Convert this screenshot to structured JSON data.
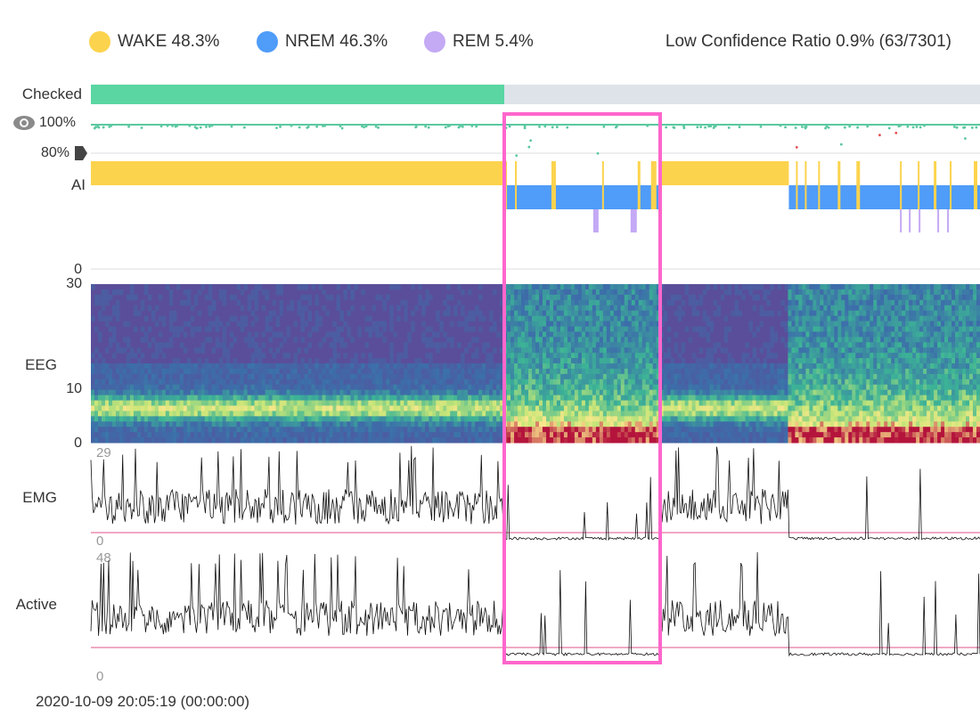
{
  "legend": {
    "items": [
      {
        "label": "WAKE 48.3%",
        "color": "#fcd34d"
      },
      {
        "label": "NREM 46.3%",
        "color": "#4f9cf9"
      },
      {
        "label": "REM 5.4%",
        "color": "#c4a9f5"
      }
    ],
    "low_confidence": "Low Confidence Ratio 0.9% (63/7301)"
  },
  "rows": {
    "checked_label": "Checked",
    "conf_100": "100%",
    "conf_80": "80%",
    "ai_label": "AI",
    "ai_zero": "0",
    "eeg_label": "EEG",
    "eeg_top": "30",
    "eeg_mid": "10",
    "eeg_bottom": "0",
    "emg_label": "EMG",
    "emg_max": "29",
    "emg_min": "0",
    "active_label": "Active",
    "active_max": "48",
    "active_min": "0"
  },
  "footer": {
    "timestamp": "2020-10-09 20:05:19 (00:00:00)"
  },
  "colors": {
    "wake": "#fcd34d",
    "nrem": "#4f9cf9",
    "rem": "#c4a9f5",
    "checked": "#5ad6a2",
    "selection": "#ff66cc",
    "threshold": "#e0508a"
  },
  "checked_progress": 0.465,
  "stage_segments": [
    {
      "stage": "WAKE",
      "from": 0.0,
      "to": 0.465
    },
    {
      "stage": "NREM",
      "from": 0.465,
      "to": 0.64
    },
    {
      "stage": "WAKE",
      "from": 0.64,
      "to": 0.785
    },
    {
      "stage": "NREM",
      "from": 0.785,
      "to": 1.0
    }
  ]
}
